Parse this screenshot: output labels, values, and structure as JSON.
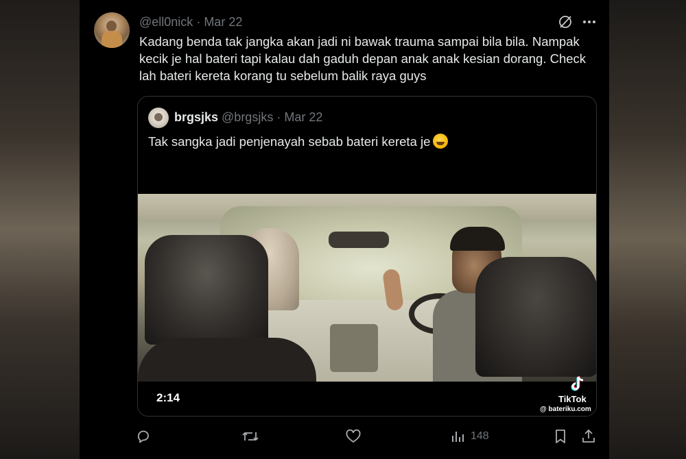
{
  "tweet": {
    "handle": "@ell0nick",
    "date": "Mar 22",
    "separator": "·",
    "text": "Kadang benda tak jangka akan jadi ni bawak trauma sampai bila bila. Nampak kecik je hal bateri tapi kalau dah gaduh depan anak anak kesian dorang. Check lah bateri kereta korang tu sebelum balik raya guys",
    "icons": {
      "grok": "grok-icon",
      "more": "more-icon"
    }
  },
  "quote": {
    "name": "brgsjks",
    "handle": "@brgsjks",
    "date": "Mar 22",
    "separator": "·",
    "text": "Tak sangka jadi penjenayah sebab bateri kereta je",
    "emoji": "rolling-on-floor-laughing-emoji",
    "video": {
      "duration": "2:14",
      "watermark_brand": "TikTok",
      "watermark_handle": "@ bateriku.com"
    }
  },
  "actions": {
    "reply_icon": "reply-icon",
    "retweet_icon": "retweet-icon",
    "like_icon": "heart-icon",
    "views_icon": "views-icon",
    "views_count": "148",
    "bookmark_icon": "bookmark-icon",
    "share_icon": "share-icon"
  },
  "colors": {
    "background": "#000000",
    "text_primary": "#e7e9ea",
    "text_secondary": "#71767b",
    "border": "#2f3336"
  }
}
